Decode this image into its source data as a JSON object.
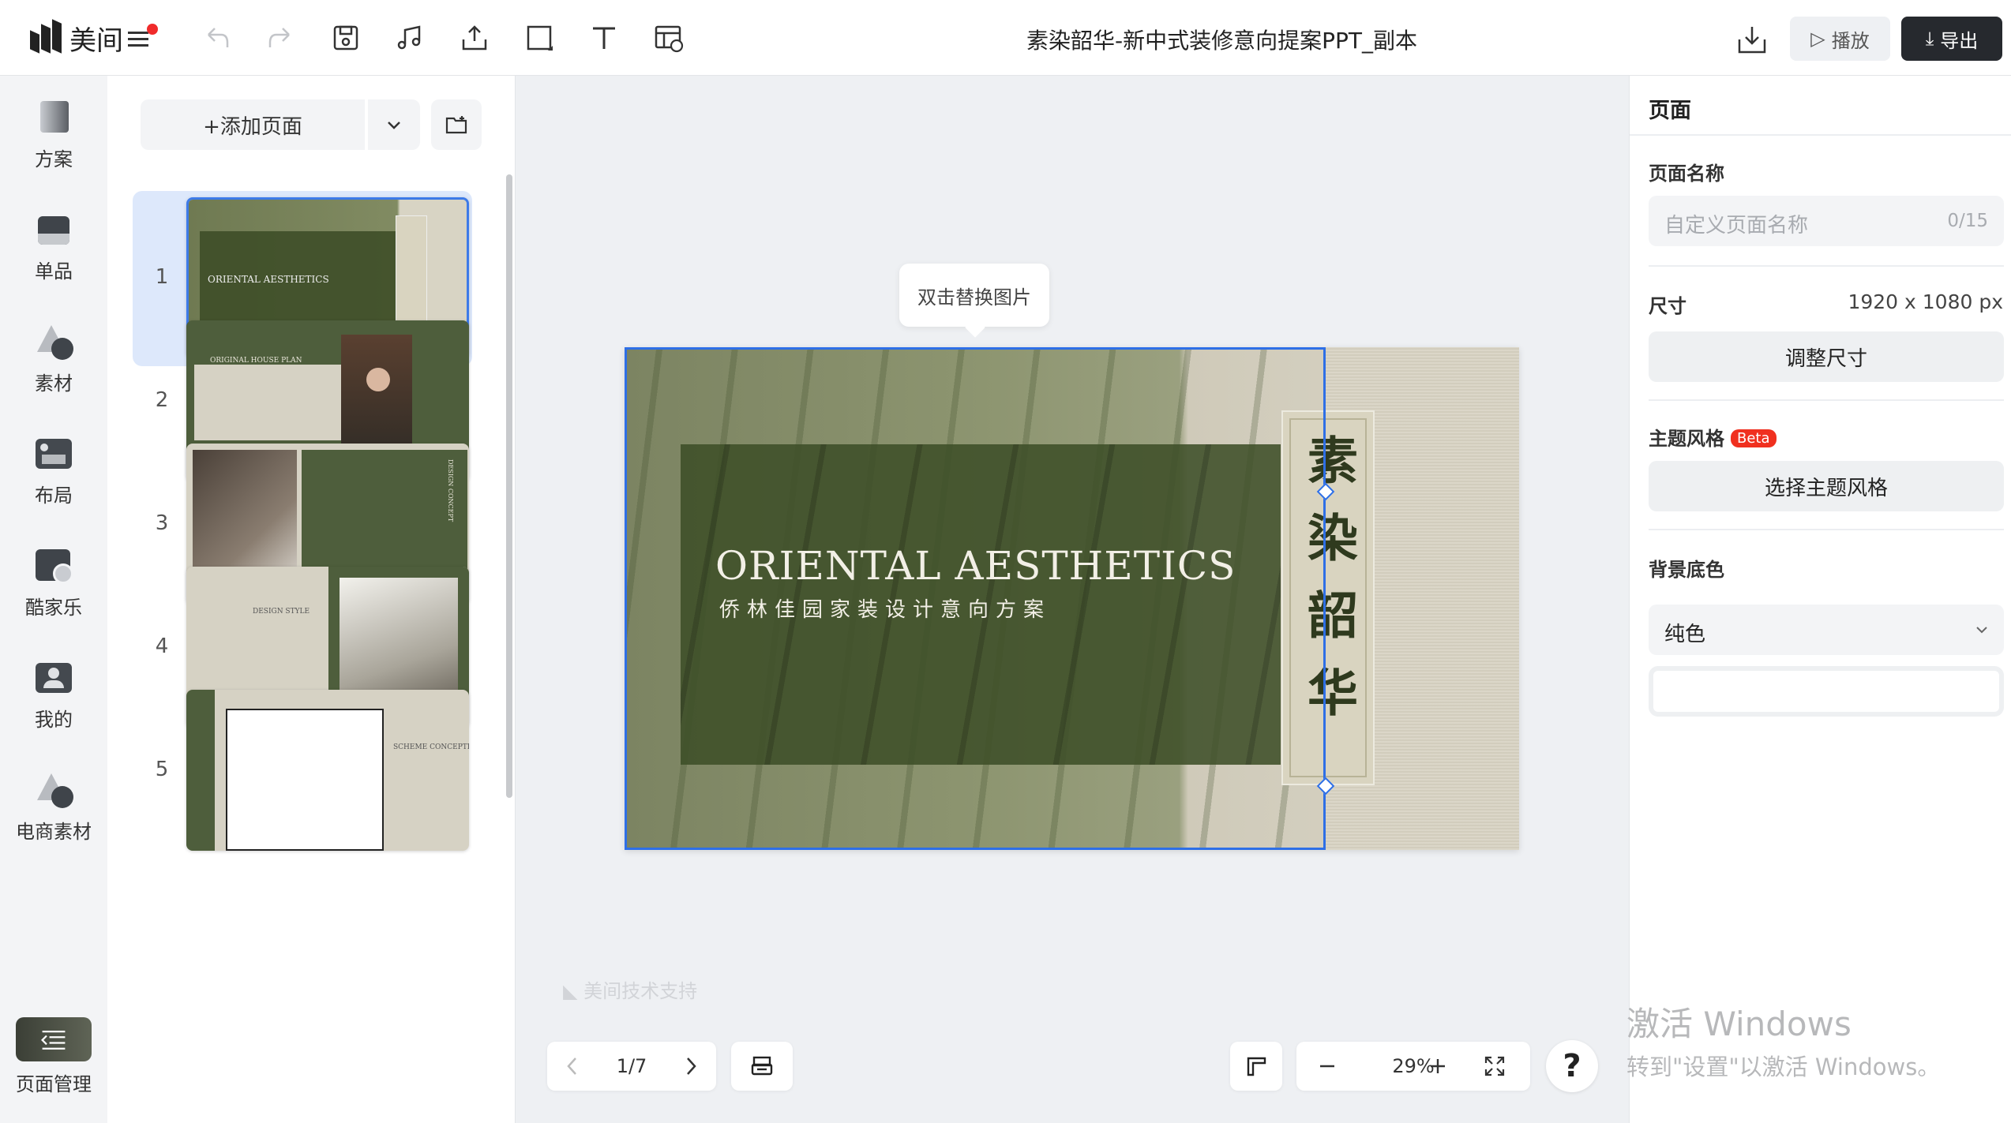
{
  "app": {
    "logo_text": "美间",
    "doc_title": "素染韶华-新中式装修意向提案PPT_副本",
    "play_label": "播放",
    "export_label": "导出"
  },
  "toolbar": {
    "icons": [
      "undo-icon",
      "redo-icon",
      "save-icon",
      "music-icon",
      "upload-icon",
      "shape-icon",
      "text-icon",
      "web-image-icon",
      "download-icon"
    ]
  },
  "rail": {
    "items": [
      {
        "label": "方案",
        "icon": "scheme-icon"
      },
      {
        "label": "单品",
        "icon": "product-icon"
      },
      {
        "label": "素材",
        "icon": "material-icon"
      },
      {
        "label": "布局",
        "icon": "layout-icon"
      },
      {
        "label": "酷家乐",
        "icon": "kujiale-icon"
      },
      {
        "label": "我的",
        "icon": "my-icon"
      },
      {
        "label": "电商素材",
        "icon": "ecommerce-icon"
      }
    ],
    "page_manager_label": "页面管理"
  },
  "pages_panel": {
    "add_page_label": "+添加页面",
    "thumbnails": [
      {
        "num": "1",
        "title": "ORIENTAL AESTHETICS"
      },
      {
        "num": "2",
        "title": "ORIGINAL HOUSE PLAN"
      },
      {
        "num": "3",
        "title": "DESIGN CONCEPT"
      },
      {
        "num": "4",
        "title": "DESIGN STYLE"
      },
      {
        "num": "5",
        "title": "SCHEME CONCEPTION"
      }
    ]
  },
  "canvas": {
    "tooltip": "双击替换图片",
    "slide_title": "ORIENTAL AESTHETICS",
    "slide_subtitle": "侨林佳园家装设计意向方案",
    "banner_text": "素染韶华",
    "watermark": "美间技术支持",
    "pager": "1/7",
    "zoom": "29%",
    "help": "?"
  },
  "right_panel": {
    "header": "页面",
    "page_name_label": "页面名称",
    "page_name_placeholder": "自定义页面名称",
    "page_name_count": "0/15",
    "size_label": "尺寸",
    "size_value": "1920 x 1080 px",
    "resize_button": "调整尺寸",
    "theme_label": "主题风格",
    "theme_badge": "Beta",
    "theme_button": "选择主题风格",
    "bg_label": "背景底色",
    "bg_type": "纯色",
    "bg_color": "#ffffff"
  },
  "os": {
    "activation_title": "激活 Windows",
    "activation_sub": "转到\"设置\"以激活 Windows。"
  }
}
